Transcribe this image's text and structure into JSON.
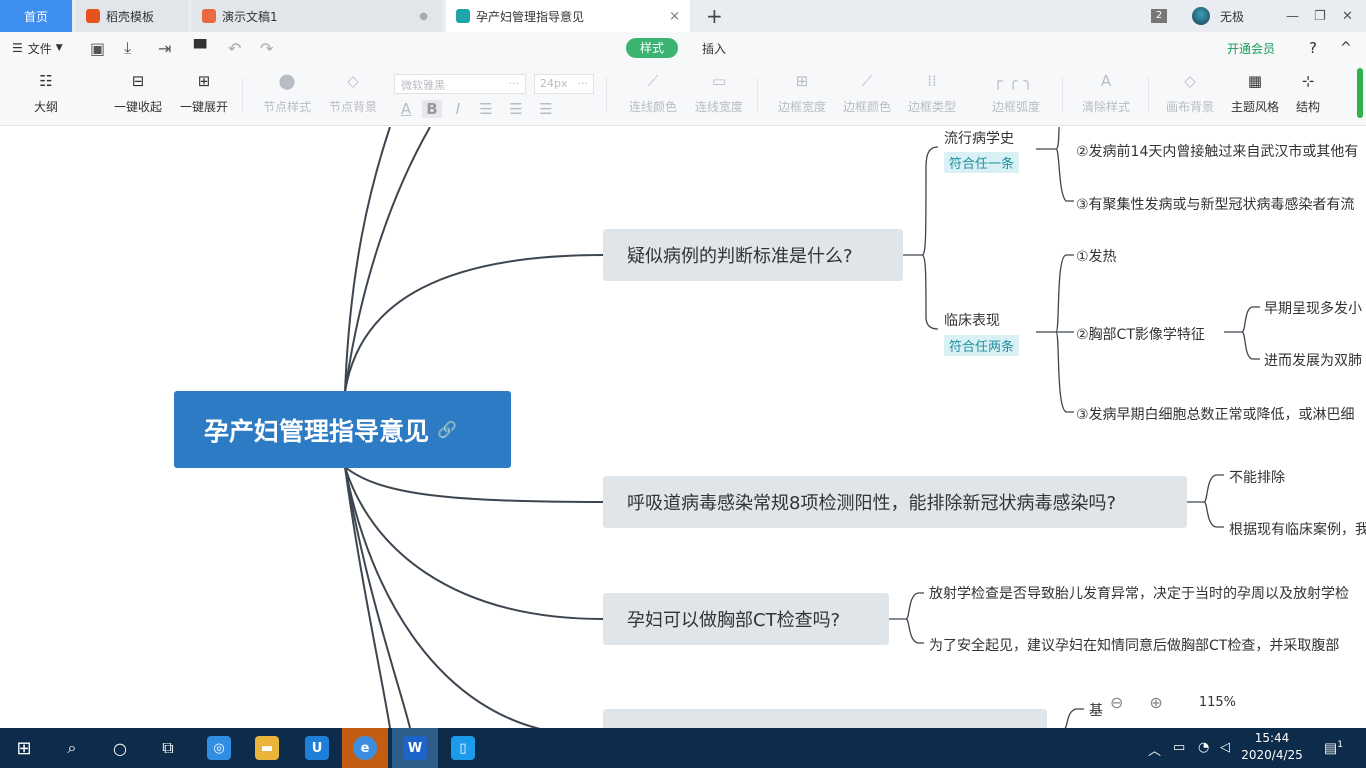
{
  "tabs": {
    "home": "首页",
    "templates": "稻壳模板",
    "presentation": "演示文稿1",
    "active": "孕产妇管理指导意见",
    "close_glyph": "×",
    "new_tab_glyph": "+"
  },
  "titlebar": {
    "window_count": "2",
    "user_name": "无极",
    "minimize": "—",
    "restore": "❐",
    "close": "✕"
  },
  "menu": {
    "file": "文件",
    "style_tab": "样式",
    "insert_tab": "插入",
    "vip": "开通会员",
    "help": "?",
    "collapse": "^"
  },
  "toolbar": {
    "outline": "大纲",
    "collapse_all": "一键收起",
    "expand_all": "一键展开",
    "node_style": "节点样式",
    "node_bg": "节点背景",
    "font_name": "微软雅黑",
    "font_size": "24px",
    "line_color": "连线颜色",
    "line_width": "连线宽度",
    "border_width": "边框宽度",
    "border_color": "边框颜色",
    "border_type": "边框类型",
    "border_radius": "边框弧度",
    "clear_style": "清除样式",
    "canvas_bg": "画布背景",
    "theme": "主题风格",
    "structure": "结构",
    "fmt_a": "A",
    "fmt_b": "B",
    "fmt_i": "I"
  },
  "mindmap": {
    "root": "孕产妇管理指导意见",
    "branches": [
      {
        "label": "疑似病例的判断标准是什么?",
        "groups": [
          {
            "title": "流行病学史",
            "tag": "符合任一条",
            "items": [
              "②发病前14天内曾接触过来自武汉市或其他有",
              "③有聚集性发病或与新型冠状病毒感染者有流"
            ]
          },
          {
            "title": "临床表现",
            "tag": "符合任两条",
            "items": [
              "①发热",
              "②胸部CT影像学特征",
              "③发病早期白细胞总数正常或降低，或淋巴细"
            ],
            "sub_items": [
              "早期呈现多发小",
              "进而发展为双肺"
            ]
          }
        ]
      },
      {
        "label": "呼吸道病毒感染常规8项检测阳性，能排除新冠状病毒感染吗?",
        "items": [
          "不能排除",
          "根据现有临床案例，我"
        ]
      },
      {
        "label": "孕妇可以做胸部CT检查吗?",
        "items": [
          "放射学检查是否导致胎儿发育异常，决定于当时的孕周以及放射学检",
          "为了安全起见，建议孕妇在知情同意后做胸部CT检查，并采取腹部"
        ]
      },
      {
        "label": "",
        "items": [
          "基"
        ]
      }
    ]
  },
  "zoom": {
    "value": "115%",
    "minus_glyph": "⊖",
    "plus_glyph": "⊕"
  },
  "taskbar": {
    "time": "15:44",
    "date": "2020/4/25",
    "notification_count": "1"
  },
  "colors": {
    "accent_green": "#3cb371",
    "root_blue": "#2d7bc4",
    "node_bg": "#dfe5e9",
    "tag_bg": "#d9f1f4",
    "taskbar": "#0d2b4a"
  }
}
